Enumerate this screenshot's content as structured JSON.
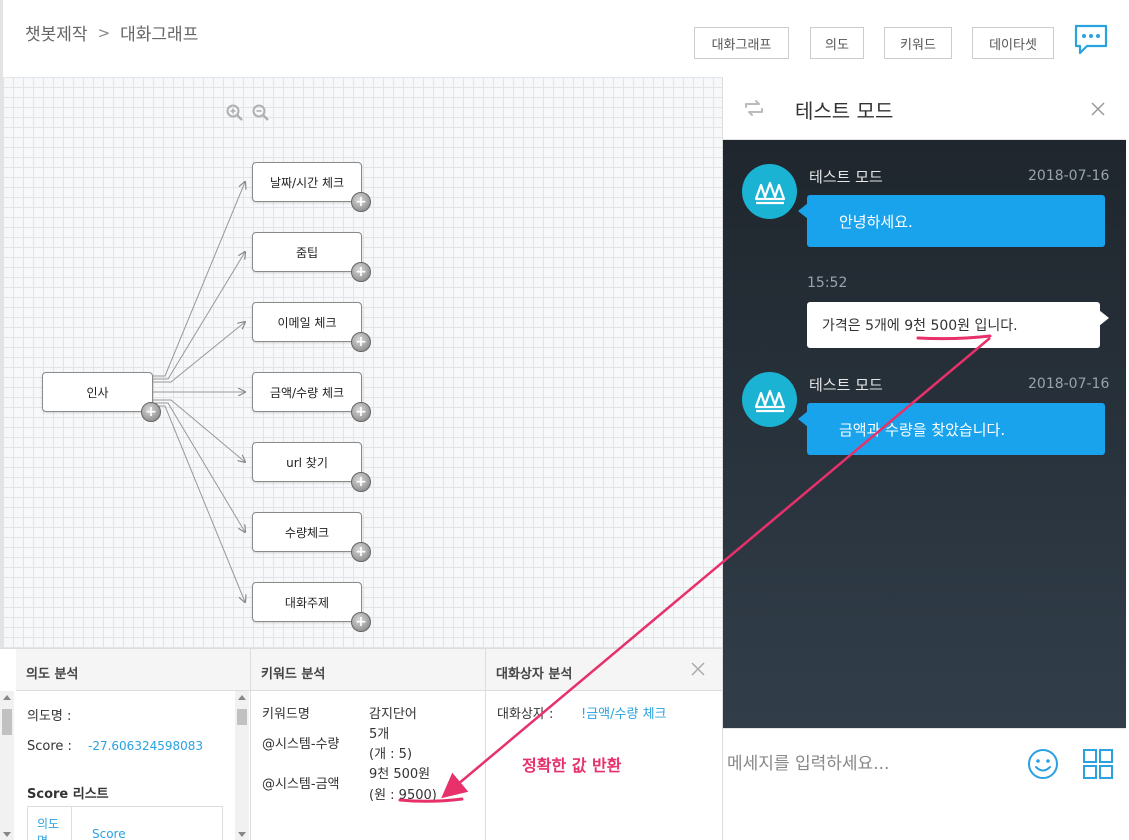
{
  "header": {
    "breadcrumb_root": "챗봇제작",
    "breadcrumb_sep": ">",
    "breadcrumb_current": "대화그래프",
    "nav": [
      "대화그래프",
      "의도",
      "키워드",
      "데이타셋"
    ]
  },
  "graph": {
    "root_label": "인사",
    "children": [
      "날짜/시간 체크",
      "줌팁",
      "이메일 체크",
      "금액/수량 체크",
      "url 찾기",
      "수량체크",
      "대화주제"
    ]
  },
  "analysis": {
    "intent": {
      "title": "의도 분석",
      "name_label": "의도명 :",
      "score_label": "Score :",
      "score_value": "-27.606324598083",
      "list_title": "Score 리스트",
      "list_col1": "의도명",
      "list_col2": "Score"
    },
    "keyword": {
      "title": "키워드 분석",
      "col_name": "키워드명",
      "col_detect": "감지단어",
      "rows": [
        {
          "name": "@시스템-수량",
          "value": "5개",
          "detail": "(개 : 5)"
        },
        {
          "name": "@시스템-금액",
          "value": "9천 500원",
          "detail": "(원 : 9500)"
        }
      ]
    },
    "partner": {
      "title": "대화상자 분석",
      "label": "대화상자 :",
      "value": "!금액/수량 체크"
    }
  },
  "test_mode": {
    "title": "테스트 모드",
    "messages": [
      {
        "sender": "테스트 모드",
        "date": "2018-07-16",
        "text": "안녕하세요."
      },
      {
        "time": "15:52",
        "text": "가격은 5개에 9천 500원 입니다."
      },
      {
        "sender": "테스트 모드",
        "date": "2018-07-16",
        "text": "금액과 수량을 찾았습니다."
      }
    ],
    "input_placeholder": "메세지를 입력하세요..."
  },
  "annotation": {
    "text": "정확한 값 반환",
    "color": "#e8306a"
  },
  "colors": {
    "accent": "#19a3ec",
    "avatar": "#1ab3d3",
    "chat_bg": "#26313b"
  }
}
